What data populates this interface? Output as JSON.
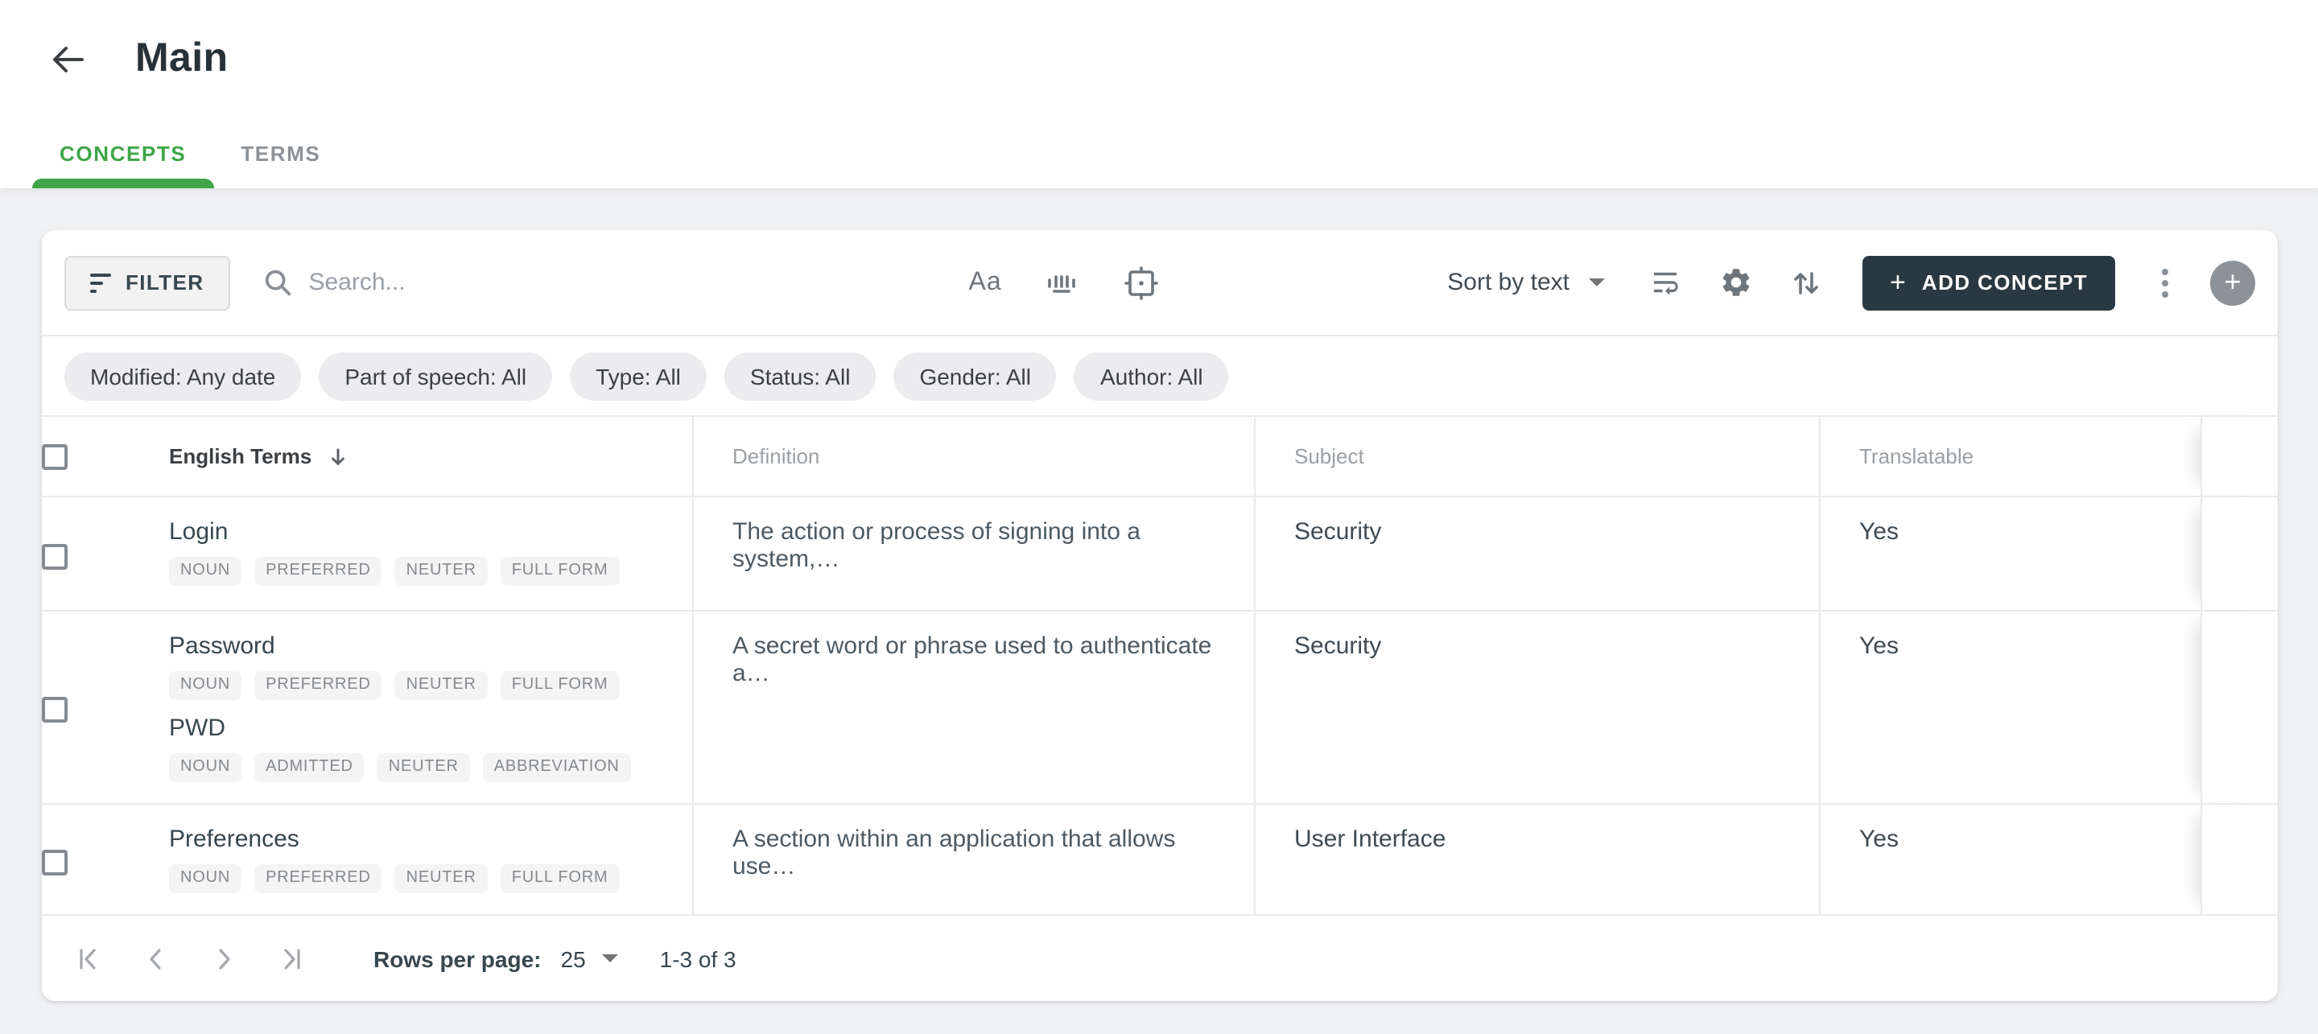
{
  "header": {
    "title": "Main"
  },
  "tabs": {
    "concepts": "CONCEPTS",
    "terms": "TERMS"
  },
  "toolbar": {
    "filter_label": "FILTER",
    "search_placeholder": "Search...",
    "sort_label": "Sort by text",
    "add_button_label": "ADD CONCEPT",
    "add_button_plus": "+",
    "match_case_glyph": "Aa"
  },
  "filters": {
    "modified": "Modified: Any date",
    "part_of_speech": "Part of speech: All",
    "type": "Type: All",
    "status": "Status: All",
    "gender": "Gender: All",
    "author": "Author: All"
  },
  "table": {
    "columns": {
      "terms": "English Terms",
      "definition": "Definition",
      "subject": "Subject",
      "translatable": "Translatable"
    },
    "rows": [
      {
        "terms": [
          {
            "text": "Login",
            "tags": [
              "NOUN",
              "PREFERRED",
              "NEUTER",
              "FULL FORM"
            ]
          }
        ],
        "definition": "The action or process of signing into a system,…",
        "subject": "Security",
        "translatable": "Yes"
      },
      {
        "terms": [
          {
            "text": "Password",
            "tags": [
              "NOUN",
              "PREFERRED",
              "NEUTER",
              "FULL FORM"
            ]
          },
          {
            "text": "PWD",
            "tags": [
              "NOUN",
              "ADMITTED",
              "NEUTER",
              "ABBREVIATION"
            ]
          }
        ],
        "definition": "A secret word or phrase used to authenticate a…",
        "subject": "Security",
        "translatable": "Yes"
      },
      {
        "terms": [
          {
            "text": "Preferences",
            "tags": [
              "NOUN",
              "PREFERRED",
              "NEUTER",
              "FULL FORM"
            ]
          }
        ],
        "definition": "A section within an application that allows use…",
        "subject": "User Interface",
        "translatable": "Yes"
      }
    ]
  },
  "pagination": {
    "rows_per_page_label": "Rows per page:",
    "rows_per_page_value": "25",
    "range_label": "1-3 of 3"
  },
  "colors": {
    "accent_green": "#3fa548",
    "dark_button": "#2a3842"
  }
}
